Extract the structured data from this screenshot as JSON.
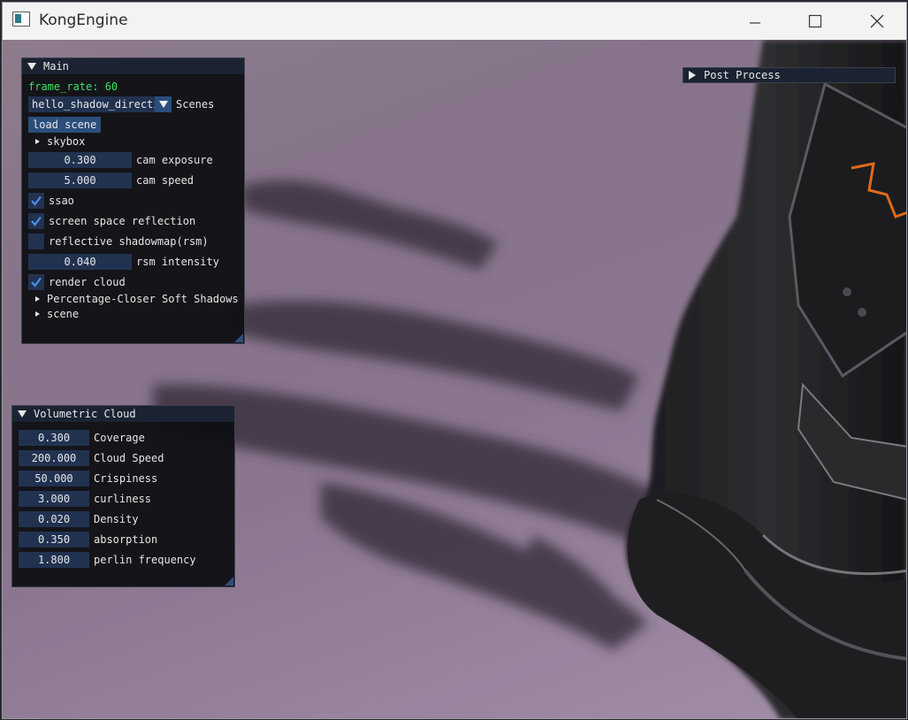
{
  "window": {
    "title": "KongEngine"
  },
  "main_panel": {
    "title": "Main",
    "frame_rate_label": "frame_rate: 60",
    "scene_combo_value": "hello_shadow_directi",
    "scene_combo_label": "Scenes",
    "load_scene_label": "load scene",
    "skybox_label": "skybox",
    "cam_exposure": {
      "value": "0.300",
      "label": "cam exposure"
    },
    "cam_speed": {
      "value": "5.000",
      "label": "cam speed"
    },
    "ssao": {
      "label": "ssao",
      "checked": true
    },
    "ssr": {
      "label": "screen space reflection",
      "checked": true
    },
    "rsm": {
      "label": "reflective shadowmap(rsm)",
      "checked": false
    },
    "rsm_intensity": {
      "value": "0.040",
      "label": "rsm intensity"
    },
    "render_cloud": {
      "label": "render cloud",
      "checked": true
    },
    "pcss_label": "Percentage-Closer Soft Shadows",
    "scene_label": "scene"
  },
  "cloud_panel": {
    "title": "Volumetric Cloud",
    "fields": [
      {
        "value": "0.300",
        "label": "Coverage"
      },
      {
        "value": "200.000",
        "label": "Cloud Speed"
      },
      {
        "value": "50.000",
        "label": "Crispiness"
      },
      {
        "value": "3.000",
        "label": "curliness"
      },
      {
        "value": "0.020",
        "label": "Density"
      },
      {
        "value": "0.350",
        "label": "absorption"
      },
      {
        "value": "1.800",
        "label": "perlin frequency"
      }
    ]
  },
  "post_panel": {
    "title": "Post Process"
  },
  "colors": {
    "accent": "#2b4e7d",
    "frame_rate": "#3fe06a",
    "checkmark": "#4d8fe8"
  }
}
